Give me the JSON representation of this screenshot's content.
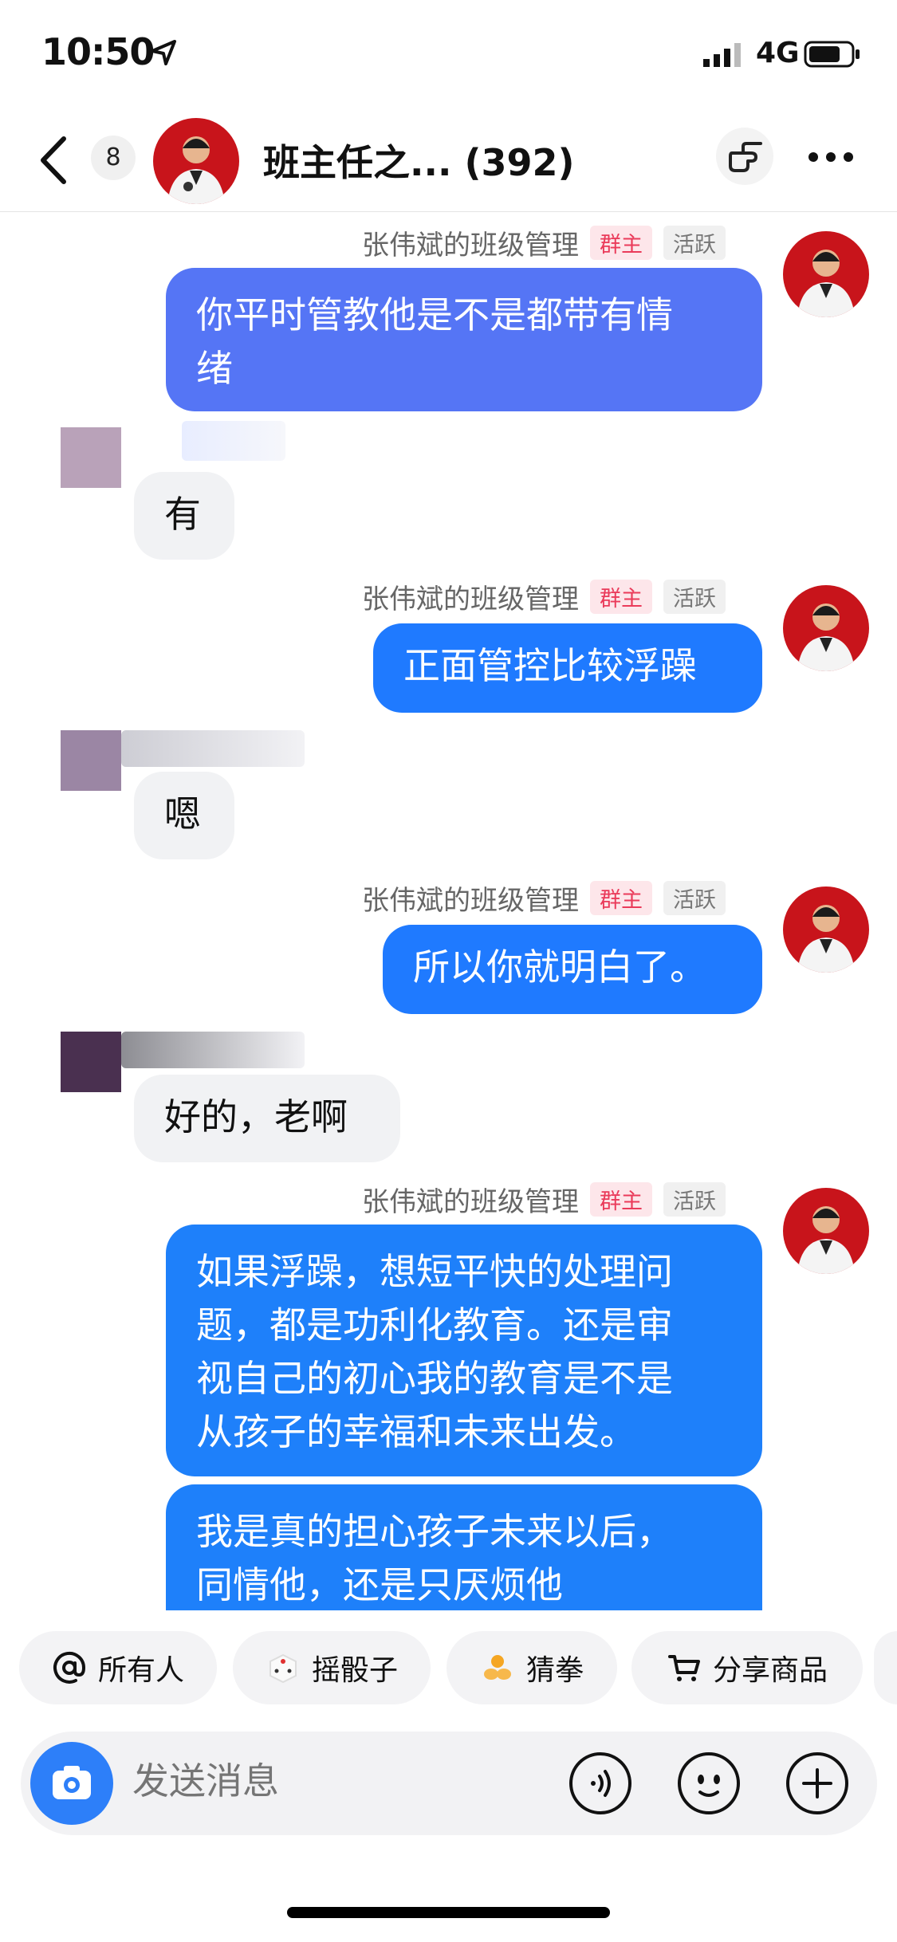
{
  "status_bar": {
    "time": "10:50",
    "network": "4G"
  },
  "header": {
    "unread_count": "8",
    "title": "班主任之... (392)"
  },
  "messages": [
    {
      "sender": "张伟斌的班级管理",
      "role": "群主",
      "activity": "活跃",
      "text_lines": [
        "你平时管教他是不是都带有情",
        "绪"
      ]
    },
    {
      "text": "有"
    },
    {
      "sender": "张伟斌的班级管理",
      "role": "群主",
      "activity": "活跃",
      "text": "正面管控比较浮躁"
    },
    {
      "text": "嗯"
    },
    {
      "sender": "张伟斌的班级管理",
      "role": "群主",
      "activity": "活跃",
      "text": "所以你就明白了。"
    },
    {
      "text": "好的，老啊"
    },
    {
      "sender": "张伟斌的班级管理",
      "role": "群主",
      "activity": "活跃",
      "text_lines": [
        "如果浮躁，想短平快的处理问",
        "题，都是功利化教育。还是审",
        "视自己的初心我的教育是不是",
        "从孩子的幸福和未来出发。"
      ]
    },
    {
      "text_lines": [
        "我是真的担心孩子未来以后，",
        "同情他，还是只厌烦他"
      ]
    }
  ],
  "quick_actions": [
    {
      "label": "所有人",
      "icon": "at-icon"
    },
    {
      "label": "摇骰子",
      "icon": "dice-icon"
    },
    {
      "label": "猜拳",
      "icon": "fist-icon"
    },
    {
      "label": "分享商品",
      "icon": "cart-icon"
    }
  ],
  "input": {
    "placeholder": "发送消息"
  },
  "colors": {
    "bubble_1": "#5575f5",
    "bubble_2": "#1f7aff",
    "accent": "#2d7ff9",
    "role_badge": "#ea3b5a"
  }
}
